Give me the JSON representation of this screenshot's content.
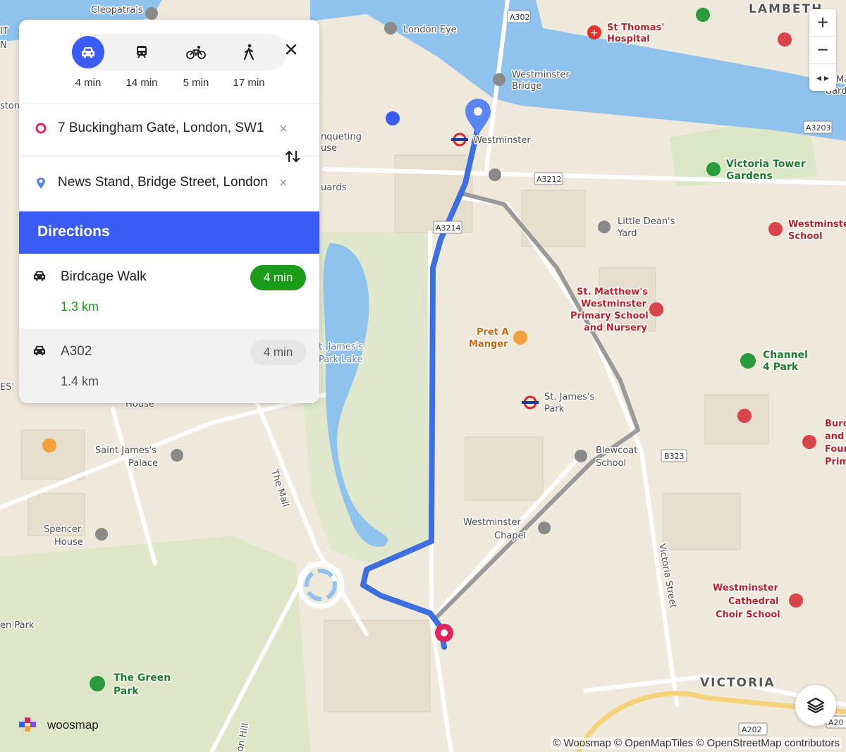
{
  "panel": {
    "modes": [
      {
        "name": "car",
        "time": "4 min",
        "active": true
      },
      {
        "name": "transit",
        "time": "14 min",
        "active": false
      },
      {
        "name": "bicycle",
        "time": "5 min",
        "active": false
      },
      {
        "name": "walk",
        "time": "17 min",
        "active": false
      }
    ],
    "origin": "7 Buckingham Gate, London, SW1",
    "destination": "News Stand, Bridge Street, London",
    "clear_glyph": "×",
    "directions_title": "Directions",
    "routes": [
      {
        "name": "Birdcage Walk",
        "distance": "1.3 km",
        "time": "4 min"
      },
      {
        "name": "A302",
        "distance": "1.4 km",
        "time": "4 min"
      }
    ]
  },
  "map": {
    "labels": {
      "lambeth": "LAMBETH",
      "victoria": "VICTORIA",
      "cleopatra": "Cleopatra's",
      "london_eye": "London Eye",
      "st_thomas_1": "St Thomas'",
      "st_thomas_2": "Hospital",
      "westminster_bridge_1": "Westminster",
      "westminster_bridge_2": "Bridge",
      "westminster_station": "Westminster",
      "banqueting_1": "nqueting",
      "banqueting_2": "use",
      "guards": "uards",
      "victoria_tower_1": "Victoria Tower",
      "victoria_tower_2": "Gardens",
      "little_deans_1": "Little Dean's",
      "little_deans_2": "Yard",
      "westminster_school_1": "Westminste",
      "westminster_school_2": "School",
      "st_matthews_1": "St. Matthew's",
      "st_matthews_2": "Westminster",
      "st_matthews_3": "Primary School",
      "st_matthews_4": "and Nursery",
      "pret_1": "Pret A",
      "pret_2": "Manger",
      "st_james_lake_1": "t. James's",
      "st_james_lake_2": "Park Lake",
      "st_james_park_1": "St. James's",
      "st_james_park_2": "Park",
      "channel4_1": "Channel",
      "channel4_2": "4 Park",
      "burd_1": "Burd",
      "burd_2": "and",
      "burd_3": "Foun",
      "burd_4": "Prim",
      "blewcoat_1": "Blewcoat",
      "blewcoat_2": "School",
      "saint_james_palace_1": "Saint James's",
      "saint_james_palace_2": "Palace",
      "house": "House",
      "the_mall": "The Mall",
      "westminster_chapel_1": "Westminster",
      "westminster_chapel_2": "Chapel",
      "spencer_1": "Spencer",
      "spencer_2": "House",
      "victoria_street": "Victoria Street",
      "cathedral_1": "Westminster",
      "cathedral_2": "Cathedral",
      "cathedral_3": "Choir School",
      "green_park_1": "The Green",
      "green_park_2": "Park",
      "en_park": "en Park",
      "on_hill": "on Hill",
      "es": "ES'",
      "it": "IT",
      "n": "N",
      "ston": "ston",
      "ma_1": "Ma",
      "ma_2": "Gard"
    },
    "road_refs": [
      "A302",
      "A3212",
      "A3214",
      "A3203",
      "B323",
      "A202",
      "A20"
    ],
    "route_colors": {
      "primary": "#3e6fe0",
      "alternative": "#9a9a9a"
    },
    "marker_colors": {
      "origin": "#e0245e",
      "destination": "#5b84f5"
    }
  },
  "controls": {
    "zoom_in": "+",
    "zoom_out": "−",
    "compass": "◂ ▸"
  },
  "brand": "woosmap",
  "attribution": "© Woosmap © OpenMapTiles © OpenStreetMap contributors"
}
